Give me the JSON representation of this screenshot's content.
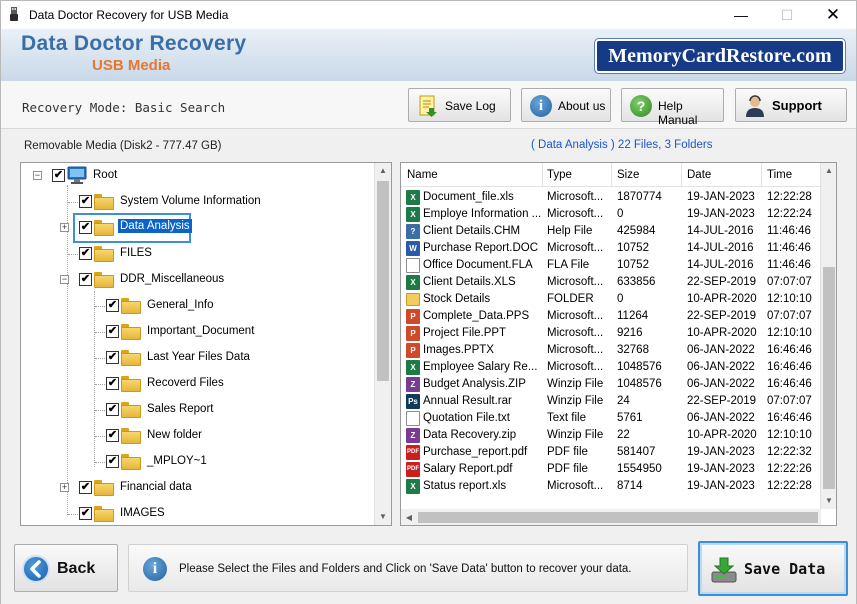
{
  "window": {
    "title": "Data Doctor Recovery for USB Media"
  },
  "banner": {
    "title": "Data Doctor Recovery",
    "subtitle": "USB Media",
    "logo": "MemoryCardRestore.com"
  },
  "toolbar": {
    "mode_text": "Recovery Mode: Basic Search",
    "save_log": "Save Log",
    "about_us": "About us",
    "help_manual": "Help Manual",
    "support": "Support"
  },
  "media": {
    "label": "Removable Media (Disk2 - 777.47 GB)",
    "info": "( Data Analysis )    22 Files, 3 Folders"
  },
  "tree": [
    {
      "label": "Root",
      "icon": "computer-icon"
    },
    {
      "label": "System Volume Information"
    },
    {
      "label": "Data Analysis"
    },
    {
      "label": "FILES"
    },
    {
      "label": "DDR_Miscellaneous"
    },
    {
      "label": "General_Info"
    },
    {
      "label": "Important_Document"
    },
    {
      "label": "Last Year Files Data"
    },
    {
      "label": "Recoverd Files"
    },
    {
      "label": "Sales Report"
    },
    {
      "label": "New folder"
    },
    {
      "label": "_MPLOY~1"
    },
    {
      "label": "Financial data"
    },
    {
      "label": "IMAGES"
    }
  ],
  "list": {
    "headers": [
      "Name",
      "Type",
      "Size",
      "Date",
      "Time"
    ],
    "rows": [
      {
        "name": "Document_file.xls",
        "type": "Microsoft...",
        "size": "1870774",
        "date": "19-JAN-2023",
        "time": "12:22:28",
        "icon": "excel-icon"
      },
      {
        "name": "Employe Information ...",
        "type": "Microsoft...",
        "size": "0",
        "date": "19-JAN-2023",
        "time": "12:22:24",
        "icon": "excel-icon"
      },
      {
        "name": "Client Details.CHM",
        "type": "Help File",
        "size": "425984",
        "date": "14-JUL-2016",
        "time": "11:46:46",
        "icon": "help-file-icon"
      },
      {
        "name": "Purchase Report.DOC",
        "type": "Microsoft...",
        "size": "10752",
        "date": "14-JUL-2016",
        "time": "11:46:46",
        "icon": "word-icon"
      },
      {
        "name": "Office Document.FLA",
        "type": "FLA File",
        "size": "10752",
        "date": "14-JUL-2016",
        "time": "11:46:46",
        "icon": "blank-file-icon"
      },
      {
        "name": "Client Details.XLS",
        "type": "Microsoft...",
        "size": "633856",
        "date": "22-SEP-2019",
        "time": "07:07:07",
        "icon": "excel-icon"
      },
      {
        "name": "Stock Details",
        "type": "FOLDER",
        "size": "0",
        "date": "10-APR-2020",
        "time": "12:10:10",
        "icon": "folder-icon"
      },
      {
        "name": "Complete_Data.PPS",
        "type": "Microsoft...",
        "size": "11264",
        "date": "22-SEP-2019",
        "time": "07:07:07",
        "icon": "powerpoint-icon"
      },
      {
        "name": "Project File.PPT",
        "type": "Microsoft...",
        "size": "9216",
        "date": "10-APR-2020",
        "time": "12:10:10",
        "icon": "powerpoint-icon"
      },
      {
        "name": "Images.PPTX",
        "type": "Microsoft...",
        "size": "32768",
        "date": "06-JAN-2022",
        "time": "16:46:46",
        "icon": "powerpoint-icon"
      },
      {
        "name": "Employee Salary Re...",
        "type": "Microsoft...",
        "size": "1048576",
        "date": "06-JAN-2022",
        "time": "16:46:46",
        "icon": "excel-icon"
      },
      {
        "name": "Budget Analysis.ZIP",
        "type": "Winzip File",
        "size": "1048576",
        "date": "06-JAN-2022",
        "time": "16:46:46",
        "icon": "zip-icon"
      },
      {
        "name": "Annual Result.rar",
        "type": "Winzip File",
        "size": "24",
        "date": "22-SEP-2019",
        "time": "07:07:07",
        "icon": "photoshop-icon"
      },
      {
        "name": "Quotation File.txt",
        "type": "Text file",
        "size": "5761",
        "date": "06-JAN-2022",
        "time": "16:46:46",
        "icon": "text-file-icon"
      },
      {
        "name": "Data Recovery.zip",
        "type": "Winzip File",
        "size": "22",
        "date": "10-APR-2020",
        "time": "12:10:10",
        "icon": "zip-icon"
      },
      {
        "name": "Purchase_report.pdf",
        "type": "PDF file",
        "size": "581407",
        "date": "19-JAN-2023",
        "time": "12:22:32",
        "icon": "pdf-icon"
      },
      {
        "name": "Salary Report.pdf",
        "type": "PDF file",
        "size": "1554950",
        "date": "19-JAN-2023",
        "time": "12:22:26",
        "icon": "pdf-icon"
      },
      {
        "name": "Status report.xls",
        "type": "Microsoft...",
        "size": "8714",
        "date": "19-JAN-2023",
        "time": "12:22:28",
        "icon": "excel-icon"
      }
    ]
  },
  "bottom": {
    "back": "Back",
    "message": "Please Select the Files and Folders and Click on 'Save Data' button to recover your data.",
    "save_data": "Save Data"
  },
  "colors": {
    "accent": "#3a6ea5",
    "subtitle": "#e8772e",
    "link": "#1a55c8",
    "selection_border": "#3d8fd6"
  }
}
